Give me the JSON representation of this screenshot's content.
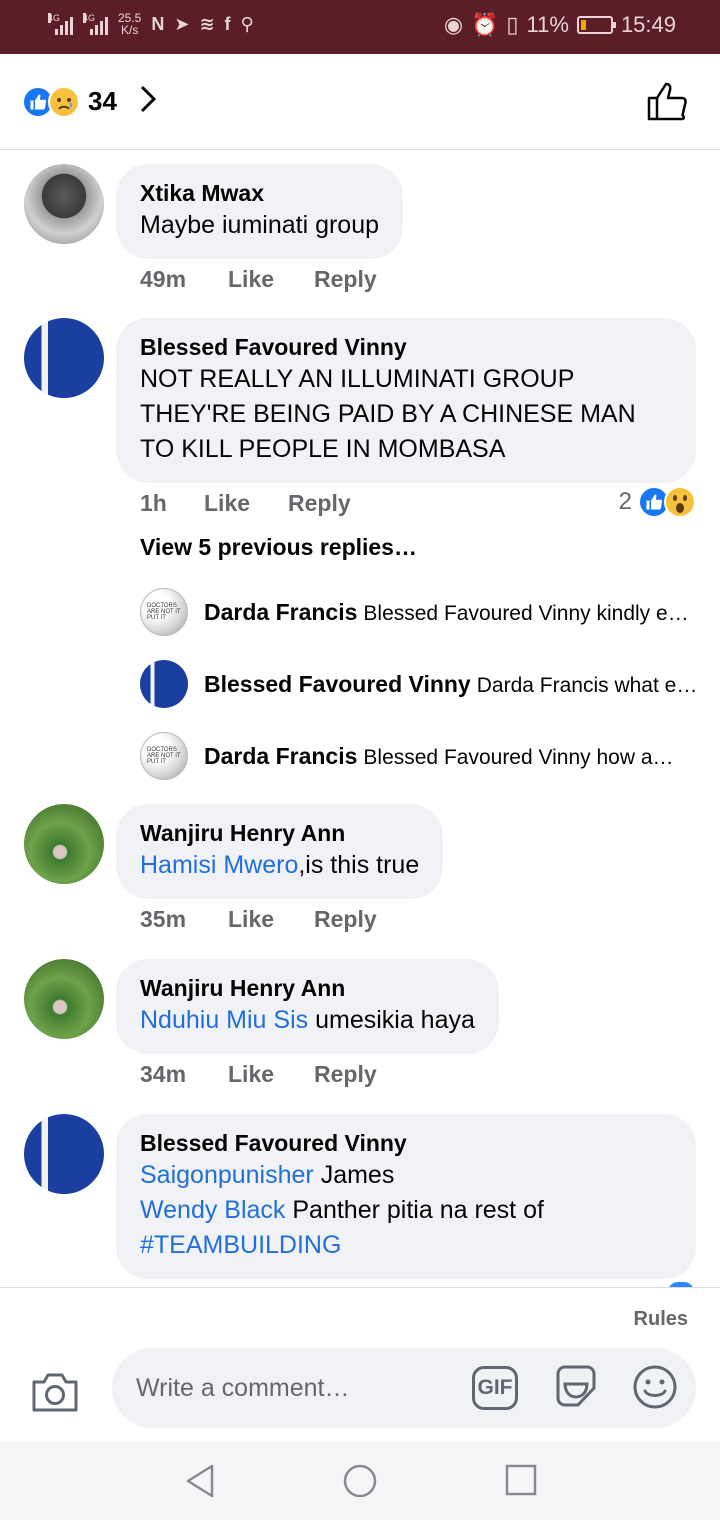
{
  "status_bar": {
    "network_label_1": "4G",
    "network_label_2": "4G",
    "speed_value": "25.5",
    "speed_unit": "K/s",
    "battery": "11%",
    "time": "15:49"
  },
  "header": {
    "reaction_count": "34",
    "reaction_icons": [
      "like-icon",
      "sad-icon"
    ]
  },
  "comments": [
    {
      "author": "Xtika Mwax",
      "text": "Maybe iuminati group",
      "age": "49m",
      "like_label": "Like",
      "reply_label": "Reply"
    },
    {
      "author": "Blessed Favoured Vinny",
      "text_line_1": "NOT REALLY AN ILLUMINATI GROUP",
      "text_line_2": "THEY'RE BEING PAID BY A CHINESE MAN",
      "text_line_3": "TO KILL PEOPLE IN MOMBASA",
      "age": "1h",
      "like_label": "Like",
      "reply_label": "Reply",
      "reaction_count": "2",
      "reaction_icons": [
        "like-icon",
        "wow-icon"
      ],
      "view_previous": "View 5 previous replies…",
      "replies": [
        {
          "author": "Darda Francis",
          "text": "Blessed Favoured Vinny kindly e…"
        },
        {
          "author": "Blessed Favoured Vinny",
          "text": "Darda Francis what e…"
        },
        {
          "author": "Darda Francis",
          "text": "Blessed Favoured Vinny  how a…"
        }
      ]
    },
    {
      "author": "Wanjiru Henry Ann",
      "mention": "Hamisi Mwero",
      "text": ",is this true",
      "age": "35m",
      "like_label": "Like",
      "reply_label": "Reply"
    },
    {
      "author": "Wanjiru Henry Ann",
      "mention": "Nduhiu Miu Sis",
      "text": " umesikia haya",
      "age": "34m",
      "like_label": "Like",
      "reply_label": "Reply"
    },
    {
      "author": "Blessed Favoured Vinny",
      "mention_1": "Saigonpunisher",
      "text_1": " James",
      "mention_2": "Wendy Black",
      "text_2": " Panther pitia na rest of",
      "hashtag": "#TEAMBUILDING"
    }
  ],
  "composer": {
    "rules_label": "Rules",
    "placeholder": "Write a comment…",
    "gif_label": "GIF"
  },
  "avatar_overlay_text": "DOCTORS ARE NOT IT PUT IT"
}
